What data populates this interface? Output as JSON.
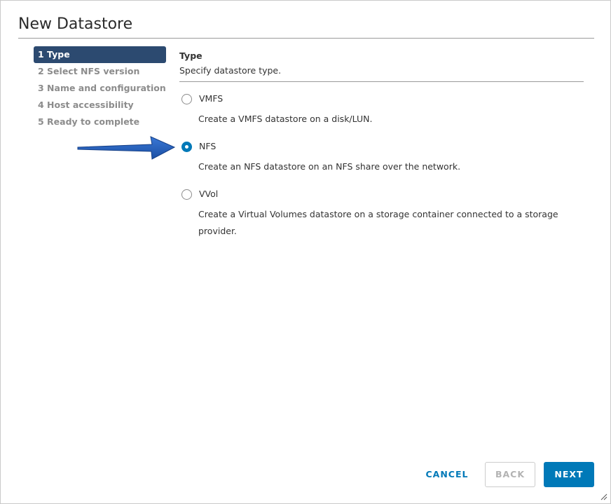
{
  "dialog": {
    "title": "New Datastore"
  },
  "steps": [
    {
      "label": "1 Type",
      "active": true
    },
    {
      "label": "2 Select NFS version",
      "active": false
    },
    {
      "label": "3 Name and configuration",
      "active": false
    },
    {
      "label": "4 Host accessibility",
      "active": false
    },
    {
      "label": "5 Ready to complete",
      "active": false
    }
  ],
  "section": {
    "title": "Type",
    "description": "Specify datastore type."
  },
  "options": [
    {
      "label": "VMFS",
      "description": "Create a VMFS datastore on a disk/LUN.",
      "selected": false
    },
    {
      "label": "NFS",
      "description": "Create an NFS datastore on an NFS share over the network.",
      "selected": true
    },
    {
      "label": "VVol",
      "description": "Create a Virtual Volumes datastore on a storage container connected to a storage provider.",
      "selected": false
    }
  ],
  "buttons": {
    "cancel": "CANCEL",
    "back": "BACK",
    "next": "NEXT"
  },
  "colors": {
    "accent": "#0079b8",
    "active_step": "#2c4a70",
    "arrow": "#1f57b8"
  },
  "icons": {
    "annotation": "arrow-right-icon",
    "grip": "resize-grip-icon"
  }
}
